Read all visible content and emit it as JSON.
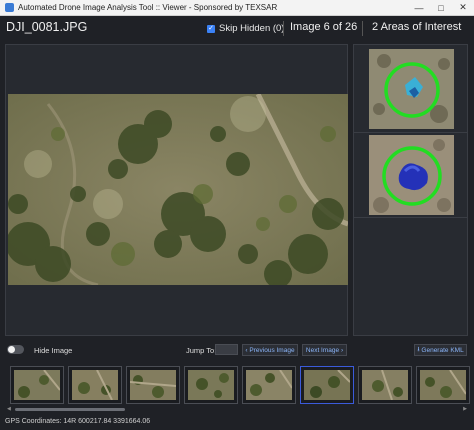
{
  "window": {
    "title": "Automated Drone Image Analysis Tool :: Viewer - Sponsored by TEXSAR"
  },
  "header": {
    "filename": "DJI_0081.JPG",
    "skip_hidden_label": "Skip Hidden (0)",
    "skip_hidden_checked": true,
    "image_counter": "Image 6 of 26",
    "areas_of_interest": "2 Areas of Interest"
  },
  "controls": {
    "hide_image_label": "Hide Image",
    "jump_to_label": "Jump To:",
    "jump_to_value": "",
    "previous_label": "Previous Image",
    "next_label": "Next Image",
    "generate_label": "Generate KML"
  },
  "thumbnails": {
    "count": 8,
    "selected_index": 5
  },
  "status": {
    "gps": "GPS Coordinates: 14R 600217.84 3391664.06"
  },
  "colors": {
    "accent": "#3b82f6",
    "aoi_circle": "#22dd22",
    "link": "#8ab4f8"
  }
}
